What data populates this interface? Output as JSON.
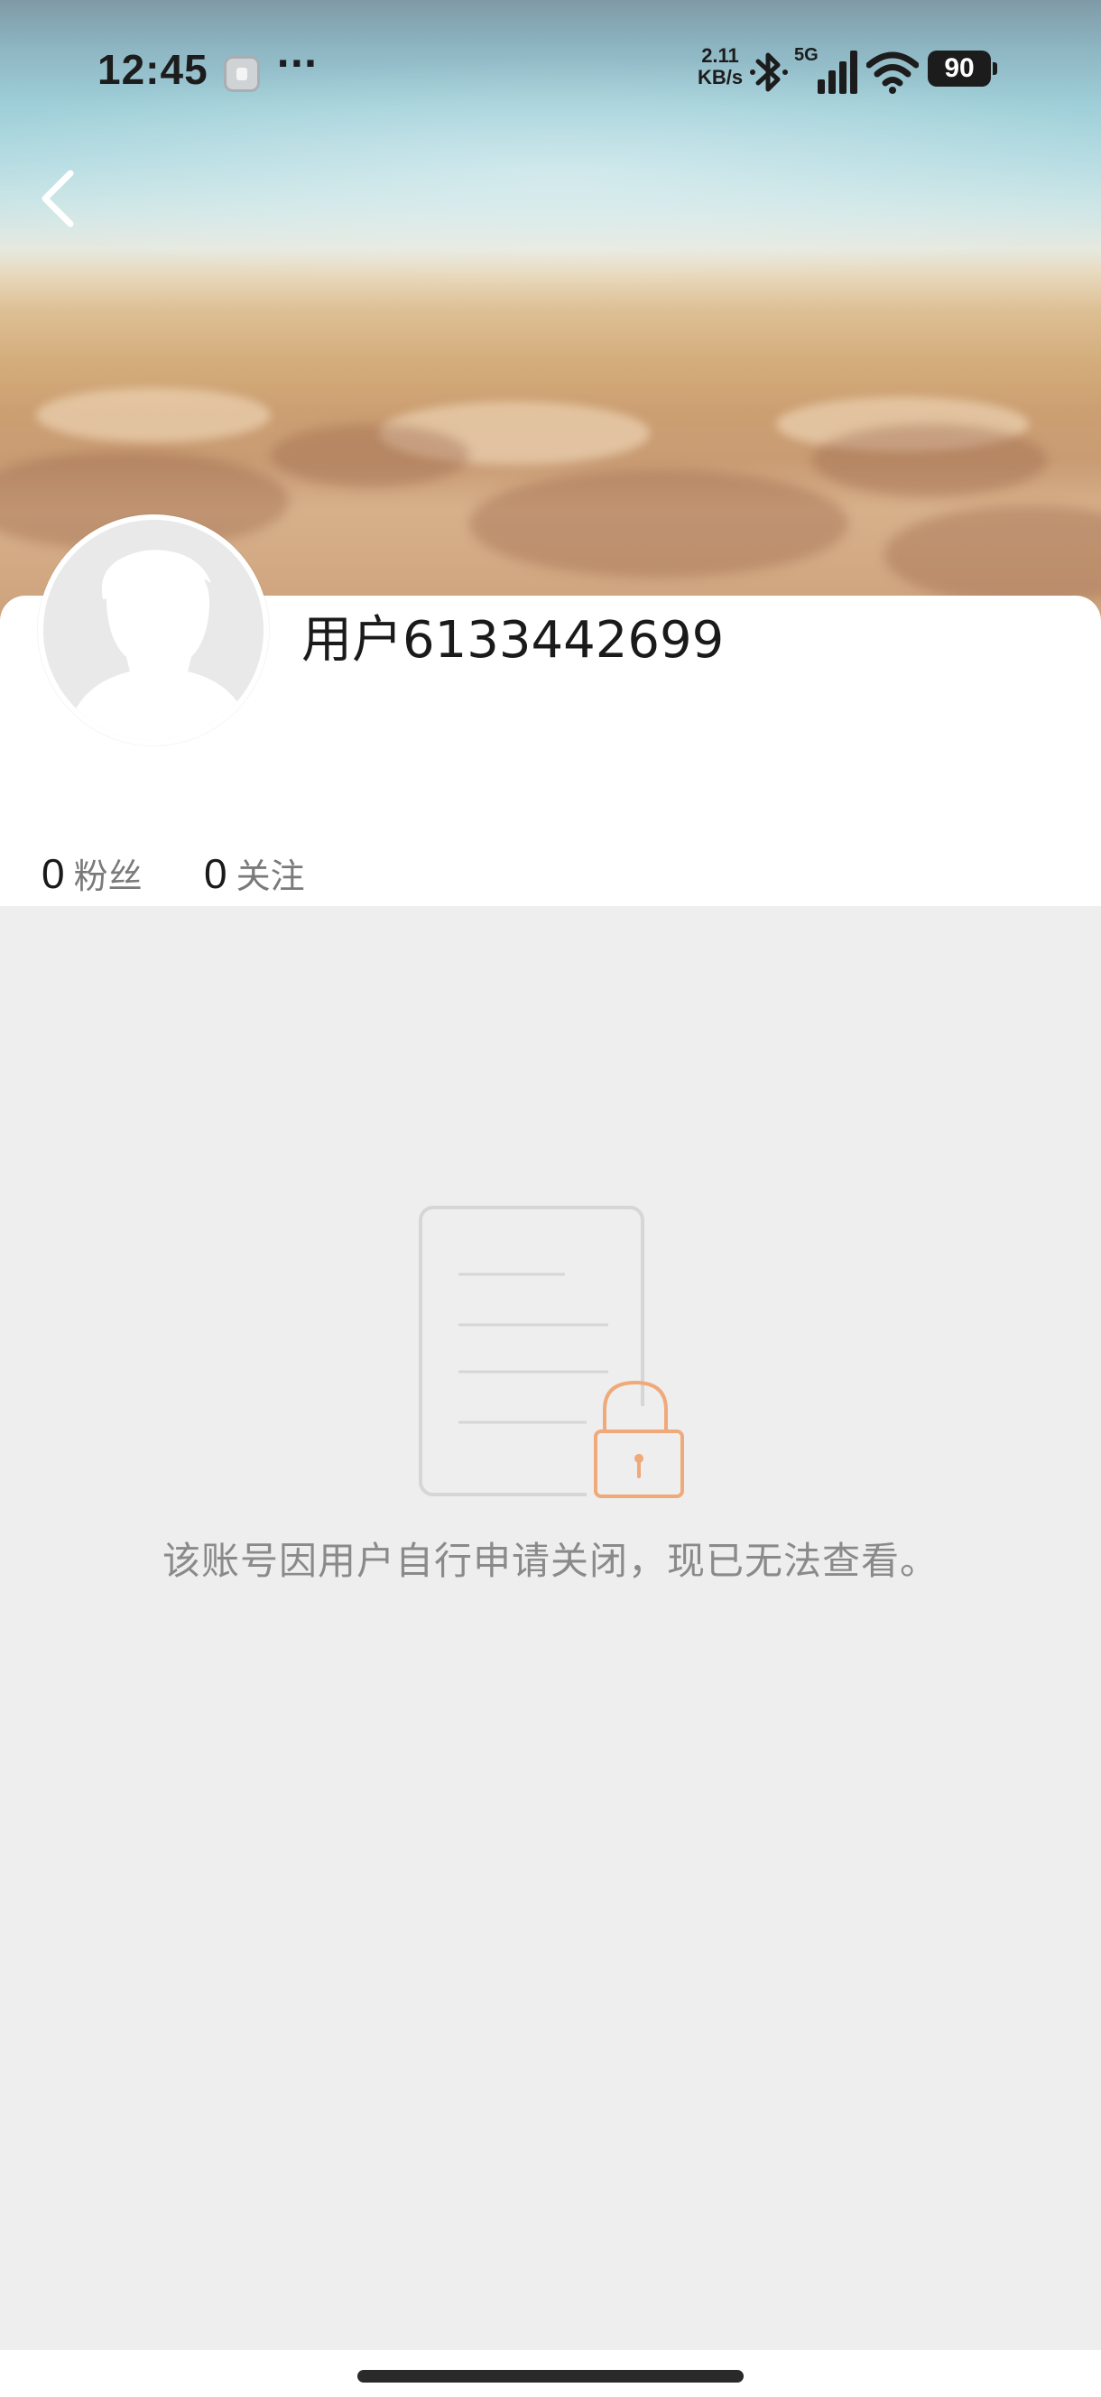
{
  "status_bar": {
    "time": "12:45",
    "more": "···",
    "speed_value": "2.11",
    "speed_unit": "KB/s",
    "network": "5G",
    "battery": "90",
    "icons": [
      "app-notification-icon",
      "bluetooth-icon",
      "signal-icon",
      "wifi-icon",
      "battery-icon"
    ]
  },
  "nav": {
    "back_icon": "chevron-left-icon"
  },
  "profile": {
    "username": "用户6133442699",
    "avatar_icon": "default-avatar-icon",
    "stats": [
      {
        "value": "0",
        "label": "粉丝"
      },
      {
        "value": "0",
        "label": "关注"
      }
    ]
  },
  "empty_state": {
    "icon": "locked-document-icon",
    "message": "该账号因用户自行申请关闭，现已无法查看。"
  },
  "colors": {
    "background": "#eeeeee",
    "card": "#ffffff",
    "accent_lock": "#f0a978",
    "message_text": "#8a8a8a"
  }
}
